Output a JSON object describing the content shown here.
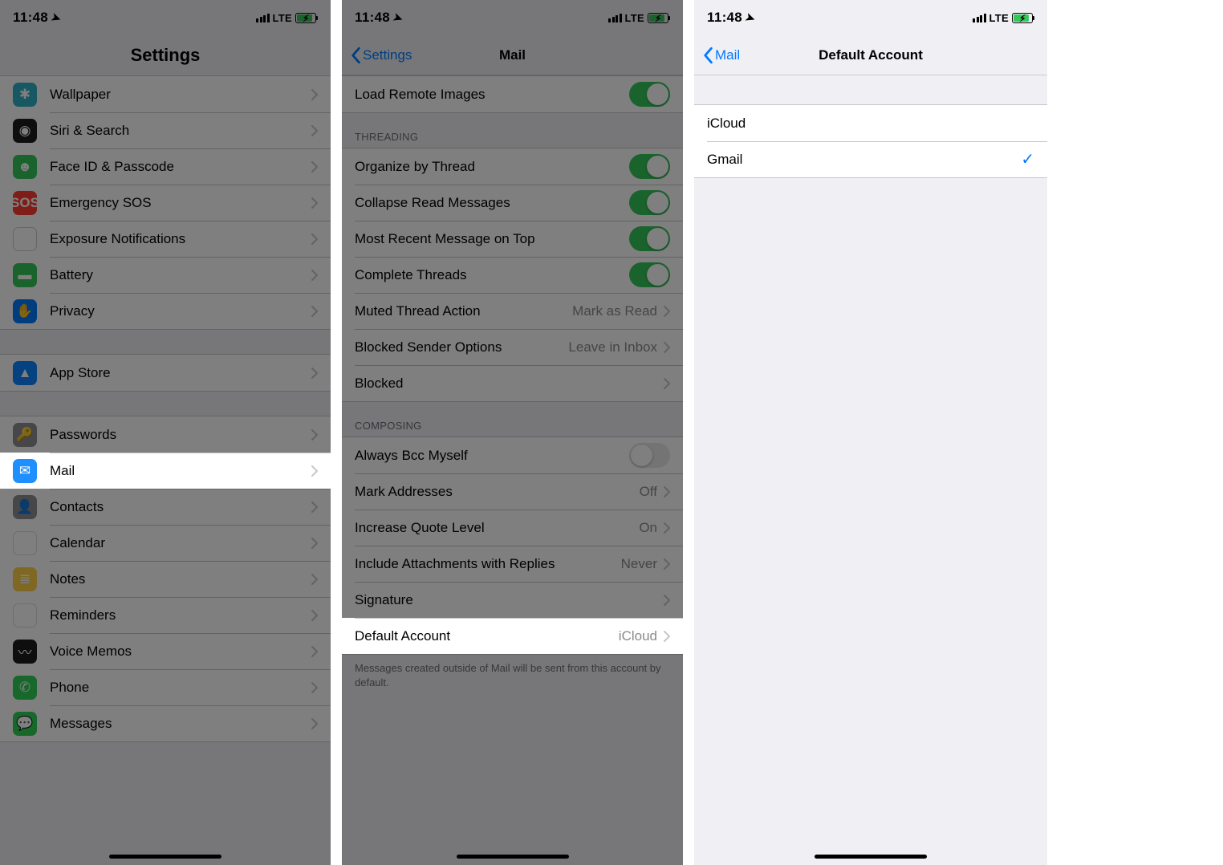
{
  "status": {
    "time": "11:48",
    "network": "LTE"
  },
  "s1": {
    "title": "Settings",
    "groups": [
      {
        "items": [
          {
            "label": "Wallpaper",
            "iconClass": "ic-wallpaper",
            "glyph": "✱"
          },
          {
            "label": "Siri & Search",
            "iconClass": "ic-siri",
            "glyph": "◉"
          },
          {
            "label": "Face ID & Passcode",
            "iconClass": "ic-faceid",
            "glyph": "☻"
          },
          {
            "label": "Emergency SOS",
            "iconClass": "ic-sos",
            "glyph": "SOS"
          },
          {
            "label": "Exposure Notifications",
            "iconClass": "ic-exposure",
            "glyph": "☀"
          },
          {
            "label": "Battery",
            "iconClass": "ic-battery",
            "glyph": "▬"
          },
          {
            "label": "Privacy",
            "iconClass": "ic-privacy",
            "glyph": "✋"
          }
        ]
      },
      {
        "items": [
          {
            "label": "App Store",
            "iconClass": "ic-appstore",
            "glyph": "▲"
          }
        ]
      },
      {
        "items": [
          {
            "label": "Passwords",
            "iconClass": "ic-passwords",
            "glyph": "🔑"
          },
          {
            "label": "Mail",
            "iconClass": "ic-mail",
            "glyph": "✉",
            "highlight": true
          },
          {
            "label": "Contacts",
            "iconClass": "ic-contacts",
            "glyph": "👤"
          },
          {
            "label": "Calendar",
            "iconClass": "ic-calendar",
            "glyph": "●●●"
          },
          {
            "label": "Notes",
            "iconClass": "ic-notes",
            "glyph": "≣"
          },
          {
            "label": "Reminders",
            "iconClass": "ic-reminders",
            "glyph": "⦿"
          },
          {
            "label": "Voice Memos",
            "iconClass": "ic-voicememos",
            "glyph": "〰"
          },
          {
            "label": "Phone",
            "iconClass": "ic-phone",
            "glyph": "✆"
          },
          {
            "label": "Messages",
            "iconClass": "ic-messages",
            "glyph": "💬"
          }
        ]
      }
    ]
  },
  "s2": {
    "back": "Settings",
    "title": "Mail",
    "top": {
      "label": "Load Remote Images",
      "toggle": true
    },
    "threading_header": "THREADING",
    "threading": [
      {
        "label": "Organize by Thread",
        "type": "toggle",
        "on": true
      },
      {
        "label": "Collapse Read Messages",
        "type": "toggle",
        "on": true
      },
      {
        "label": "Most Recent Message on Top",
        "type": "toggle",
        "on": true
      },
      {
        "label": "Complete Threads",
        "type": "toggle",
        "on": true
      },
      {
        "label": "Muted Thread Action",
        "type": "link",
        "value": "Mark as Read"
      },
      {
        "label": "Blocked Sender Options",
        "type": "link",
        "value": "Leave in Inbox"
      },
      {
        "label": "Blocked",
        "type": "link"
      }
    ],
    "composing_header": "COMPOSING",
    "composing": [
      {
        "label": "Always Bcc Myself",
        "type": "toggle",
        "on": false
      },
      {
        "label": "Mark Addresses",
        "type": "link",
        "value": "Off"
      },
      {
        "label": "Increase Quote Level",
        "type": "link",
        "value": "On"
      },
      {
        "label": "Include Attachments with Replies",
        "type": "link",
        "value": "Never"
      },
      {
        "label": "Signature",
        "type": "link"
      },
      {
        "label": "Default Account",
        "type": "link",
        "value": "iCloud",
        "highlight": true
      }
    ],
    "footer": "Messages created outside of Mail will be sent from this account by default."
  },
  "s3": {
    "back": "Mail",
    "title": "Default Account",
    "accounts": [
      {
        "label": "iCloud",
        "selected": false
      },
      {
        "label": "Gmail",
        "selected": true
      }
    ]
  }
}
